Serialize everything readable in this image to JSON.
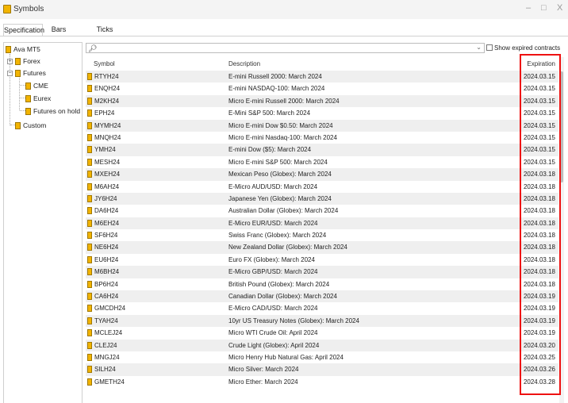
{
  "window": {
    "title": "Symbols",
    "minimize": "–",
    "maximize": "□",
    "close": "X"
  },
  "tabs": [
    {
      "label": "Specification",
      "active": true
    },
    {
      "label": "Bars",
      "active": false
    },
    {
      "label": "Ticks",
      "active": false
    }
  ],
  "tree": {
    "root": "Ava MT5",
    "items": [
      {
        "label": "Forex",
        "toggle": "+"
      },
      {
        "label": "Futures",
        "toggle": "−"
      },
      {
        "label": "CME"
      },
      {
        "label": "Eurex"
      },
      {
        "label": "Futures on hold"
      },
      {
        "label": "Custom"
      }
    ]
  },
  "search": {
    "value": "",
    "icon": "search-icon"
  },
  "show_expired": {
    "label": "Show expired contracts",
    "checked": false
  },
  "table": {
    "headers": {
      "symbol": "Symbol",
      "description": "Description",
      "expiration": "Expiration"
    },
    "rows": [
      {
        "symbol": "RTYH24",
        "description": "E-mini Russell 2000: March 2024",
        "expiration": "2024.03.15"
      },
      {
        "symbol": "ENQH24",
        "description": "E-mini NASDAQ-100: March 2024",
        "expiration": "2024.03.15"
      },
      {
        "symbol": "M2KH24",
        "description": "Micro E-mini Russell 2000: March 2024",
        "expiration": "2024.03.15"
      },
      {
        "symbol": "EPH24",
        "description": "E-Mini S&P 500: March 2024",
        "expiration": "2024.03.15"
      },
      {
        "symbol": "MYMH24",
        "description": "Micro E-mini Dow $0.50: March 2024",
        "expiration": "2024.03.15"
      },
      {
        "symbol": "MNQH24",
        "description": "Micro E-mini Nasdaq-100: March 2024",
        "expiration": "2024.03.15"
      },
      {
        "symbol": "YMH24",
        "description": "E-mini Dow ($5): March 2024",
        "expiration": "2024.03.15"
      },
      {
        "symbol": "MESH24",
        "description": "Micro E-mini S&P 500: March 2024",
        "expiration": "2024.03.15"
      },
      {
        "symbol": "MXEH24",
        "description": "Mexican Peso (Globex): March 2024",
        "expiration": "2024.03.18"
      },
      {
        "symbol": "M6AH24",
        "description": "E-Micro AUD/USD: March 2024",
        "expiration": "2024.03.18"
      },
      {
        "symbol": "JY6H24",
        "description": "Japanese Yen (Globex): March 2024",
        "expiration": "2024.03.18"
      },
      {
        "symbol": "DA6H24",
        "description": "Australian Dollar (Globex): March 2024",
        "expiration": "2024.03.18"
      },
      {
        "symbol": "M6EH24",
        "description": "E-Micro EUR/USD: March 2024",
        "expiration": "2024.03.18"
      },
      {
        "symbol": "SF6H24",
        "description": "Swiss Franc (Globex): March 2024",
        "expiration": "2024.03.18"
      },
      {
        "symbol": "NE6H24",
        "description": "New Zealand Dollar (Globex): March 2024",
        "expiration": "2024.03.18"
      },
      {
        "symbol": "EU6H24",
        "description": "Euro FX (Globex): March 2024",
        "expiration": "2024.03.18"
      },
      {
        "symbol": "M6BH24",
        "description": "E-Micro GBP/USD: March 2024",
        "expiration": "2024.03.18"
      },
      {
        "symbol": "BP6H24",
        "description": "British Pound (Globex): March 2024",
        "expiration": "2024.03.18"
      },
      {
        "symbol": "CA6H24",
        "description": "Canadian Dollar (Globex): March 2024",
        "expiration": "2024.03.19"
      },
      {
        "symbol": "GMCDH24",
        "description": "E-Micro CAD/USD: March 2024",
        "expiration": "2024.03.19"
      },
      {
        "symbol": "TYAH24",
        "description": "10yr US Treasury Notes (Globex): March 2024",
        "expiration": "2024.03.19"
      },
      {
        "symbol": "MCLEJ24",
        "description": "Micro WTI Crude Oil: April 2024",
        "expiration": "2024.03.19"
      },
      {
        "symbol": "CLEJ24",
        "description": "Crude Light (Globex): April 2024",
        "expiration": "2024.03.20"
      },
      {
        "symbol": "MNGJ24",
        "description": "Micro Henry Hub Natural Gas: April 2024",
        "expiration": "2024.03.25"
      },
      {
        "symbol": "SILH24",
        "description": "Micro Silver: March 2024",
        "expiration": "2024.03.26"
      },
      {
        "symbol": "GMETH24",
        "description": "Micro Ether: March 2024",
        "expiration": "2024.03.28"
      }
    ]
  },
  "colors": {
    "highlight": "#ee1111",
    "symbol_icon": "#f2b400",
    "row_alt": "#efefef"
  }
}
